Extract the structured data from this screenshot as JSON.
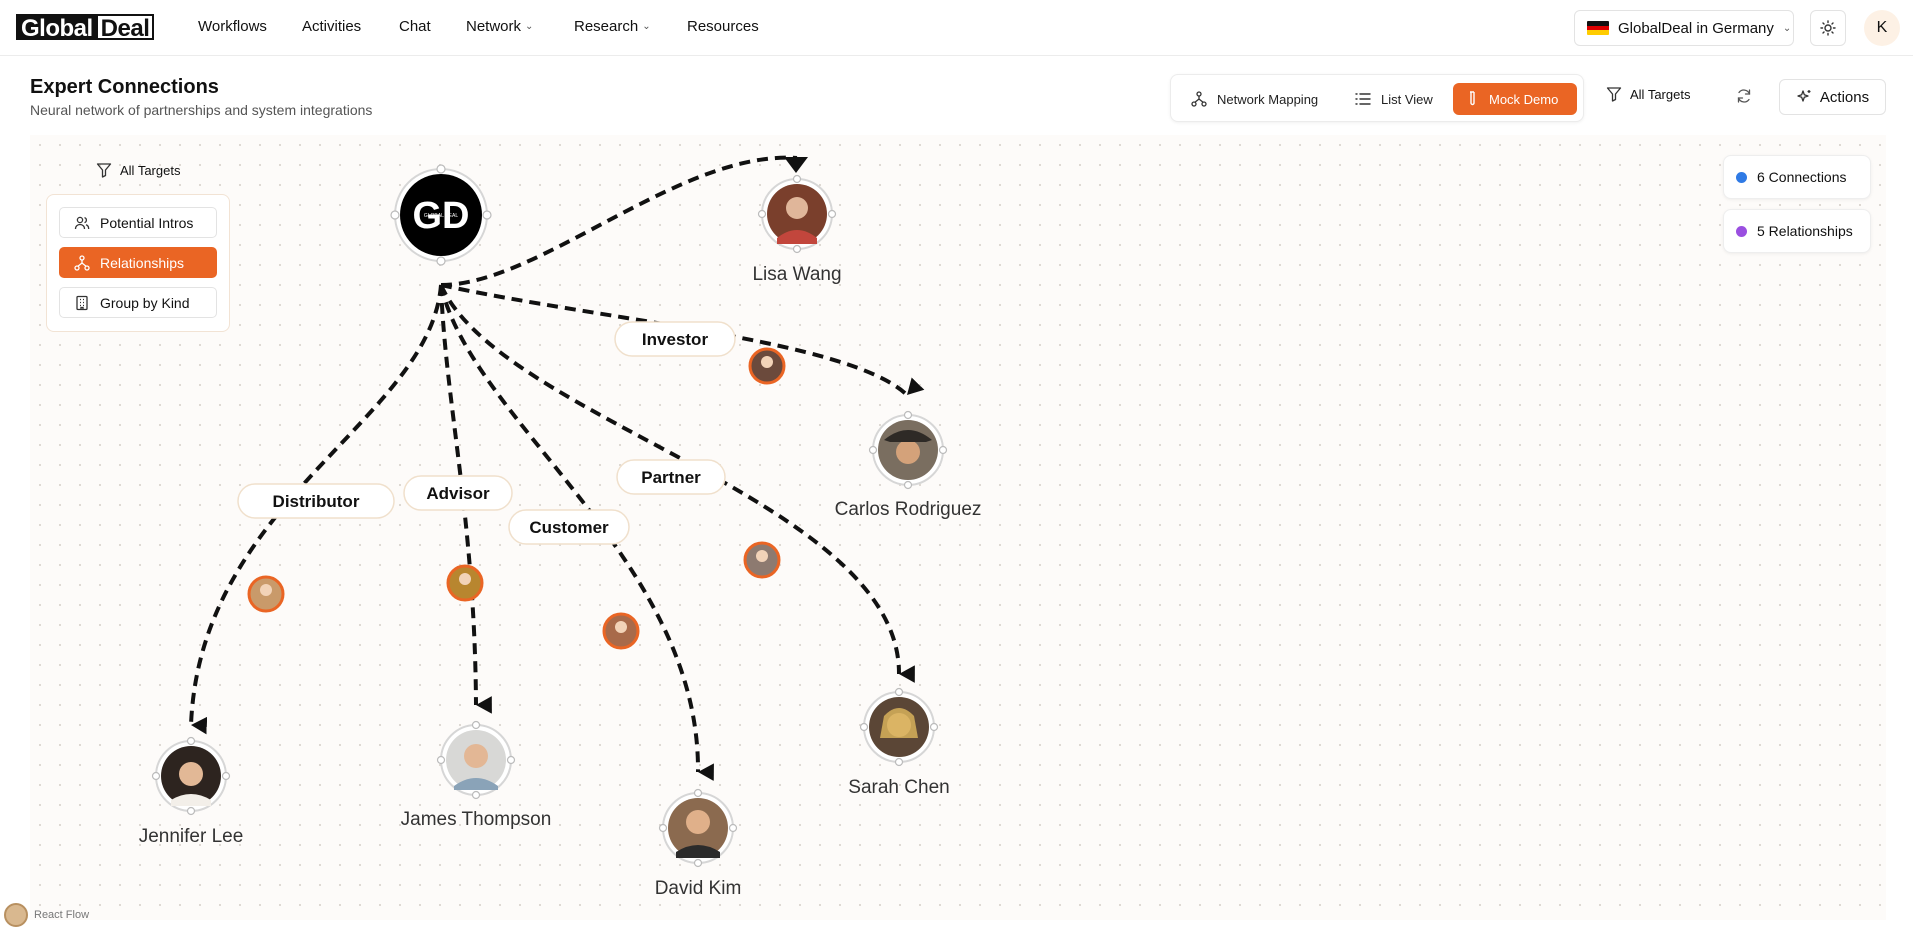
{
  "nav": {
    "logo_a": "Global",
    "logo_b": "Deal",
    "items": [
      {
        "label": "Workflows"
      },
      {
        "label": "Activities"
      },
      {
        "label": "Chat"
      },
      {
        "label": "Network",
        "dropdown": true
      },
      {
        "label": "Research",
        "dropdown": true
      },
      {
        "label": "Resources"
      }
    ],
    "country": "GlobalDeal in Germany",
    "user_initial": "K"
  },
  "header": {
    "title": "Expert Connections",
    "subtitle": "Neural network of partnerships and system integrations"
  },
  "view_toggle": {
    "network_mapping": "Network Mapping",
    "list_view": "List View",
    "mock_demo": "Mock Demo",
    "active": "Mock Demo"
  },
  "toolbar": {
    "filter_label": "All Targets",
    "actions_label": "Actions"
  },
  "left_panel": {
    "filter_label": "All Targets",
    "buttons": [
      {
        "label": "Potential Intros"
      },
      {
        "label": "Relationships"
      },
      {
        "label": "Group by Kind"
      }
    ],
    "active": "Relationships"
  },
  "stats": {
    "connections": "6 Connections",
    "relationships": "5 Relationships",
    "connections_color": "#2f7ae5",
    "relationships_color": "#9a4fe0"
  },
  "graph": {
    "hub": {
      "label": "GD",
      "sublabel": "GLOBAL DEAL"
    },
    "people": [
      {
        "name": "Lisa Wang"
      },
      {
        "name": "Carlos Rodriguez"
      },
      {
        "name": "Jennifer Lee"
      },
      {
        "name": "James Thompson"
      },
      {
        "name": "David Kim"
      },
      {
        "name": "Sarah Chen"
      }
    ],
    "edge_labels": [
      {
        "label": "Investor"
      },
      {
        "label": "Distributor"
      },
      {
        "label": "Advisor"
      },
      {
        "label": "Customer"
      },
      {
        "label": "Partner"
      }
    ]
  },
  "colors": {
    "accent": "#ea6524",
    "edge": "#111111"
  },
  "footer": {
    "attribution": "React Flow"
  }
}
